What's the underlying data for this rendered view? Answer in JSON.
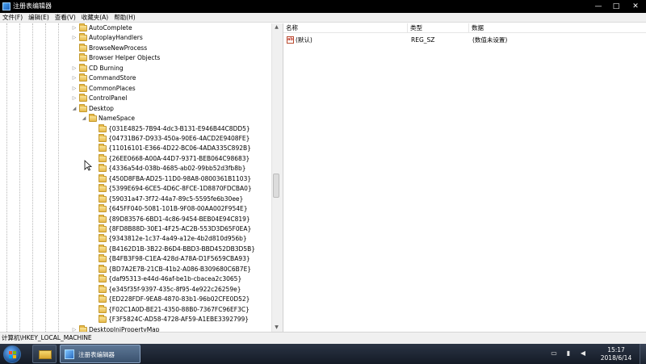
{
  "window": {
    "title": "注册表编辑器",
    "controls": {
      "minimize": "—",
      "maximize": "□",
      "close": "✕"
    }
  },
  "menu": [
    "文件(F)",
    "编辑(E)",
    "查看(V)",
    "收藏夹(A)",
    "帮助(H)"
  ],
  "tree": {
    "top_items": [
      {
        "label": "AutoComplete",
        "expander": "▷"
      },
      {
        "label": "AutoplayHandlers",
        "expander": "▷"
      },
      {
        "label": "BrowseNewProcess",
        "expander": ""
      },
      {
        "label": "Browser Helper Objects",
        "expander": ""
      },
      {
        "label": "CD Burning",
        "expander": "▷"
      },
      {
        "label": "CommandStore",
        "expander": "▷"
      },
      {
        "label": "CommonPlaces",
        "expander": "▷"
      },
      {
        "label": "ControlPanel",
        "expander": "▷"
      },
      {
        "label": "Desktop",
        "expander": "◢"
      }
    ],
    "namespace": {
      "label": "NameSpace",
      "expander": "◢"
    },
    "namespace_children": [
      "{031E4825-7B94-4dc3-B131-E946B44C8DD5}",
      "{04731B67-D933-450a-90E6-4ACD2E9408FE}",
      "{11016101-E366-4D22-BC06-4ADA335C892B}",
      "{26EE0668-A00A-44D7-9371-BEB064C98683}",
      "{4336a54d-038b-4685-ab02-99bb52d3fb8b}",
      "{450D8FBA-AD25-11D0-98A8-0800361B1103}",
      "{5399E694-6CE5-4D6C-8FCE-1D8870FDCBA0}",
      "{59031a47-3f72-44a7-89c5-5595fe6b30ee}",
      "{645FF040-5081-101B-9F08-00AA002F954E}",
      "{89D83576-6BD1-4c86-9454-BEB04E94C819}",
      "{8FD8B88D-30E1-4F25-AC2B-553D3D65F0EA}",
      "{9343812e-1c37-4a49-a12e-4b2d810d956b}",
      "{B4162D1B-3B22-B6D4-BBD3-BBD452DB3D5B}",
      "{B4FB3F98-C1EA-428d-A78A-D1F5659CBA93}",
      "{BD7A2E7B-21CB-41b2-A086-B309680C6B7E}",
      "{daf95313-e44d-46af-be1b-cbacea2c3065}",
      "{e345f35f-9397-435c-8f95-4e922c26259e}",
      "{ED228FDF-9EA8-4870-83b1-96b02CFE0D52}",
      "{F02C1A0D-BE21-4350-88B0-7367FC96EF3C}",
      "{F3F5824C-AD58-4728-AF59-A1EBE3392799}"
    ],
    "bottom_items": [
      {
        "label": "DesktopIniPropertyMap",
        "expander": "▷"
      }
    ]
  },
  "list": {
    "columns": [
      "名称",
      "类型",
      "数据"
    ],
    "rows": [
      {
        "icon": "ab",
        "name": "(默认)",
        "type": "REG_SZ",
        "data": "(数值未设置)"
      }
    ]
  },
  "status": {
    "path": "计算机\\HKEY_LOCAL_MACHINE"
  },
  "taskbar": {
    "active_app_label": "注册表编辑器",
    "clock_time": "15:17",
    "clock_date": "2018/6/14"
  },
  "colors": {
    "titlebar": "#000000",
    "window_bg": "#ffffff",
    "chrome": "#f0f0f0",
    "taskbar": "#1c2430"
  }
}
